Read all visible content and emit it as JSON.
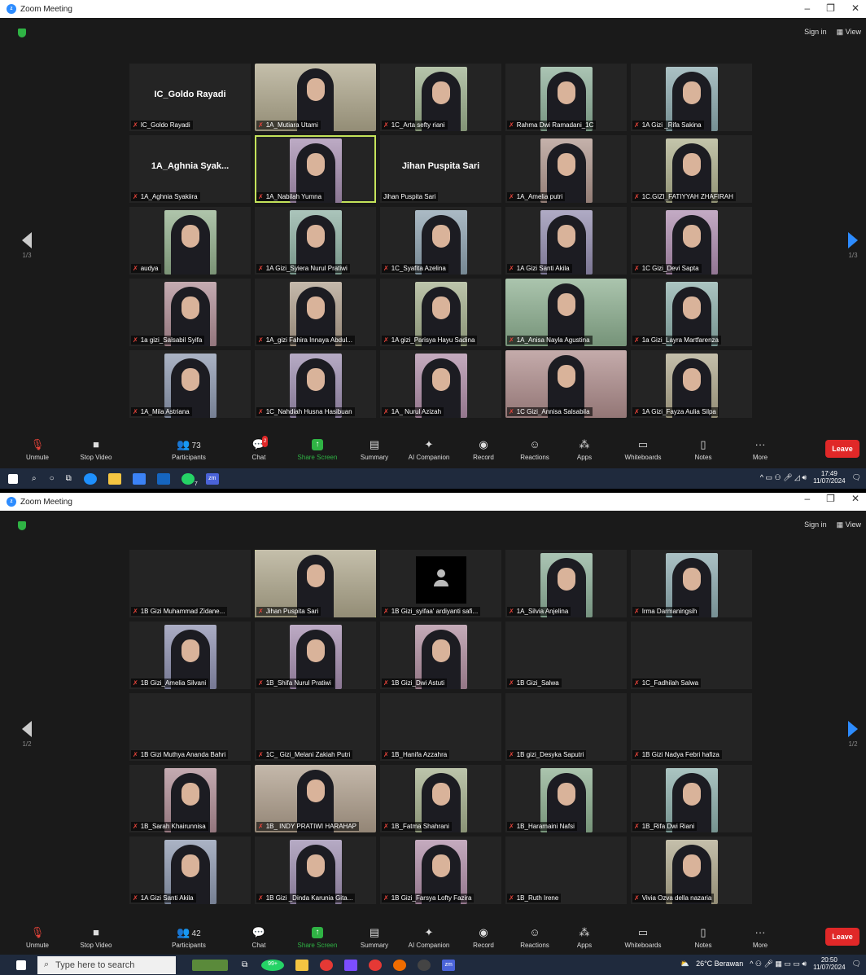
{
  "shot1": {
    "window_title": "Zoom Meeting",
    "sign_in": "Sign in",
    "view": "View",
    "page_label": "1/3",
    "tiles": [
      {
        "name": "IC_Goldo Rayadi",
        "big": "IC_Goldo Rayadi",
        "video": false
      },
      {
        "name": "1A_Mutiara Utami",
        "video": true,
        "wide": true
      },
      {
        "name": "1C_Arta sefty riani",
        "video": true
      },
      {
        "name": "Rahma Dwi Ramadani_1C",
        "video": true
      },
      {
        "name": "1A Gizi _Rifa Sakina",
        "video": true
      },
      {
        "name": "1A_Aghnia Syakiira",
        "big": "1A_Aghnia  Syak...",
        "video": false
      },
      {
        "name": "1A_Nabilah Yumna",
        "video": true,
        "speaking": true
      },
      {
        "name": "Jihan Puspita Sari",
        "big": "Jihan Puspita Sari",
        "video": false,
        "nomic": true
      },
      {
        "name": "1A_Amelia putri",
        "video": true
      },
      {
        "name": "1C.GIZI_FATIYYAH ZHAFIRAH",
        "video": true
      },
      {
        "name": "audya",
        "video": true
      },
      {
        "name": "1A Gizi_Syiera Nurul Pratiwi",
        "video": true
      },
      {
        "name": "1C_Syafita Azelina",
        "video": true
      },
      {
        "name": "1A Gizi Santi Akila",
        "video": true
      },
      {
        "name": "1C Gizi_Devi Sapta",
        "video": true
      },
      {
        "name": "1a gizi_Salsabil Syifa",
        "video": true
      },
      {
        "name": "1A_gizi Fahira Innaya Abdul...",
        "video": true
      },
      {
        "name": "1A gizi_Parisya Hayu Sadina",
        "video": true
      },
      {
        "name": "1A_Anisa Nayla Agustina",
        "video": true,
        "wide": true
      },
      {
        "name": "1a Gizi_Layra Martfarenza",
        "video": true
      },
      {
        "name": "1A_Mila Astriana",
        "video": true
      },
      {
        "name": "1C_Nahdiah Husna Hasibuan",
        "video": true
      },
      {
        "name": "1A_ Nurul Azizah",
        "video": true
      },
      {
        "name": "1C Gizi_Annisa Salsabila",
        "video": true,
        "wide": true
      },
      {
        "name": "1A Gizi_Fayza Aulia Silpa",
        "video": true
      }
    ],
    "toolbar": {
      "unmute": "Unmute",
      "stop_video": "Stop Video",
      "participants": "Participants",
      "participants_count": "73",
      "chat": "Chat",
      "chat_badge": "2",
      "share": "Share Screen",
      "summary": "Summary",
      "ai": "AI Companion",
      "record": "Record",
      "reactions": "Reactions",
      "apps": "Apps",
      "whiteboards": "Whiteboards",
      "notes": "Notes",
      "more": "More",
      "leave": "Leave"
    },
    "taskbar": {
      "time": "17:49",
      "date": "11/07/2024",
      "whatsapp_badge": "7",
      "zoom": "zm"
    }
  },
  "shot2": {
    "window_title": "Zoom Meeting",
    "sign_in": "Sign in",
    "view": "View",
    "page_label": "1/2",
    "tiles": [
      {
        "name": "1B Gizi Muhammad Zidane...",
        "video": false
      },
      {
        "name": "Jihan Puspita Sari",
        "video": true,
        "speaking": true,
        "wide": true
      },
      {
        "name": "1B Gizi_syifaa' ardiyanti safi...",
        "video": false,
        "avatar": true
      },
      {
        "name": "1A_Silvia Anjelina",
        "video": true
      },
      {
        "name": "Irma Darmaningsih",
        "video": true
      },
      {
        "name": "1B Gizi_Amelia Silvani",
        "video": true
      },
      {
        "name": "1B_Shifa Nurul Pratiwi",
        "video": true
      },
      {
        "name": "1B Gizi_Dwi Astuti",
        "video": true
      },
      {
        "name": "1B Gizi_Salwa",
        "video": false
      },
      {
        "name": "1C_Fadhilah Salwa",
        "video": false
      },
      {
        "name": "1B Gizi Muthya Ananda Bahri",
        "video": false
      },
      {
        "name": "1C_ Gizi_Melani Zakiah Putri",
        "video": false
      },
      {
        "name": "1B_Hanifa Azzahra",
        "video": false
      },
      {
        "name": "1B gizi_Desyka Saputri",
        "video": false
      },
      {
        "name": "1B Gizi Nadya Febri hafiza",
        "video": false
      },
      {
        "name": "1B_Sarah Khairunnisa",
        "video": true
      },
      {
        "name": "1B_ INDY PRATIWI HARAHAP",
        "video": true,
        "wide": true
      },
      {
        "name": "1B_Fatma Shahrani",
        "video": true
      },
      {
        "name": "1B_Haramaini Nafsi",
        "video": true
      },
      {
        "name": "1B_Rifa Dwi Riani",
        "video": true
      },
      {
        "name": "1A Gizi Santi Akila",
        "video": true
      },
      {
        "name": "1B Gizi _Dinda Karunia Gita...",
        "video": true
      },
      {
        "name": "1B Gizi_Farsya Lofty Fazira",
        "video": true
      },
      {
        "name": "1B_Ruth Irene",
        "video": false
      },
      {
        "name": "Vivia Ozva della nazaria",
        "video": true
      }
    ],
    "toolbar": {
      "unmute": "Unmute",
      "stop_video": "Stop Video",
      "participants": "Participants",
      "participants_count": "42",
      "chat": "Chat",
      "share": "Share Screen",
      "summary": "Summary",
      "ai": "AI Companion",
      "record": "Record",
      "reactions": "Reactions",
      "apps": "Apps",
      "whiteboards": "Whiteboards",
      "notes": "Notes",
      "more": "More",
      "leave": "Leave"
    },
    "taskbar": {
      "search_placeholder": "Type here to search",
      "badge": "99+",
      "weather": "26°C  Berawan",
      "time": "20:50",
      "date": "11/07/2024",
      "zoom": "zm"
    }
  }
}
